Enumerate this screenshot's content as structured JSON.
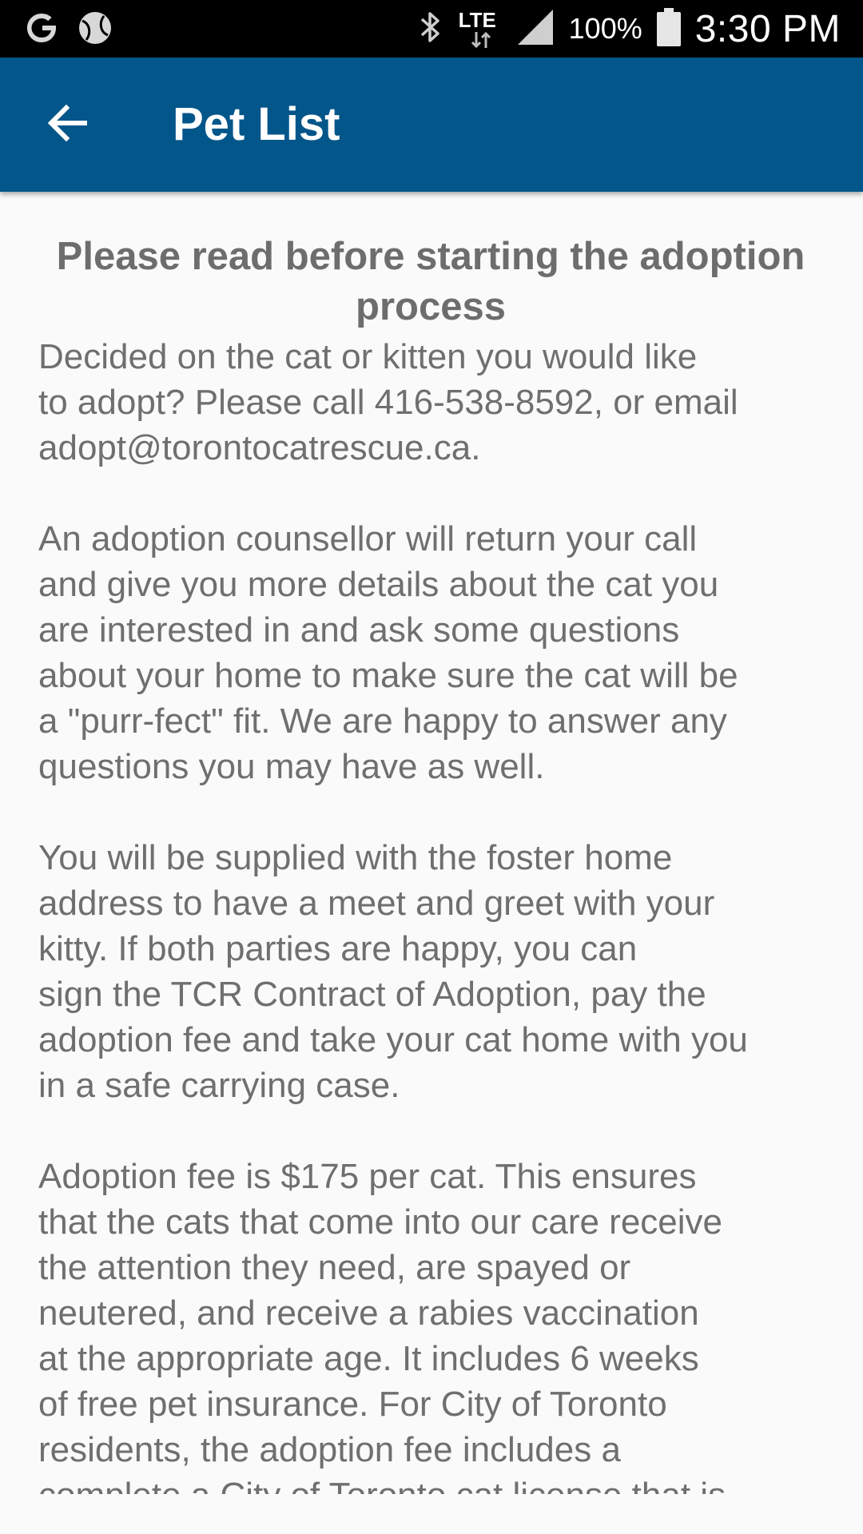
{
  "status_bar": {
    "battery_percent": "100%",
    "time": "3:30 PM",
    "network": "LTE",
    "icons": [
      "google-icon",
      "ball-icon",
      "bluetooth-icon",
      "lte-icon",
      "signal-icon",
      "battery-icon"
    ]
  },
  "app_bar": {
    "title": "Pet List",
    "back_icon": "arrow-back-icon",
    "color": "#03568a"
  },
  "content": {
    "heading": "Please read before starting the adoption process",
    "paragraphs": [
      "Decided on the cat or kitten you would like\nto adopt? Please call 416-538-8592, or email\nadopt@torontocatrescue.ca.",
      "An adoption counsellor will return your call\nand give you more details about the cat you\nare interested in and ask some questions\nabout your home to make sure the cat will be\na \"purr-fect\" fit. We are happy to answer any\nquestions you may have as well.",
      "You will be supplied with the foster home\naddress to have a meet and greet with your\nkitty. If both parties are happy, you can\nsign the TCR Contract of Adoption, pay the\nadoption fee and take your cat home with you\nin a safe carrying case.",
      "Adoption fee is $175 per cat. This ensures\nthat the cats that come into our care receive\nthe attention they need, are spayed or\nneutered, and receive a rabies vaccination\nat the appropriate age. It includes 6 weeks\nof free pet insurance. For City of Toronto\nresidents, the adoption fee includes a\ncomplete a City of Toronto cat license that is"
    ]
  }
}
